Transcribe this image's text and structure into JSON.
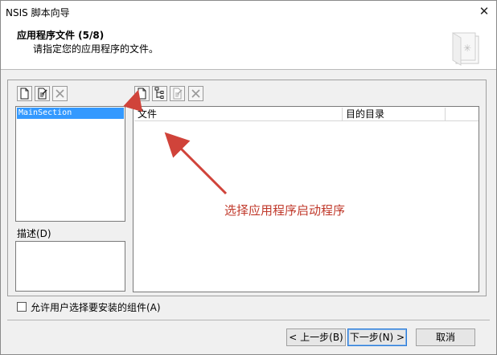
{
  "window": {
    "title": "NSIS 脚本向导",
    "close_glyph": "✕"
  },
  "header": {
    "title": "应用程序文件 (5/8)",
    "subtitle": "请指定您的应用程序的文件。",
    "icon": "wizard-page-icon"
  },
  "sections_toolbar": {
    "icons": [
      "new-file-icon",
      "edit-icon",
      "delete-icon"
    ]
  },
  "sections_list": {
    "items": [
      "MainSection"
    ],
    "selected": "MainSection"
  },
  "description": {
    "label": "描述(D)",
    "value": ""
  },
  "files_toolbar": {
    "icons": [
      "new-file-icon",
      "add-directory-icon",
      "edit-icon",
      "delete-icon"
    ]
  },
  "files_list": {
    "columns": [
      "文件",
      "目的目录"
    ],
    "rows": []
  },
  "annotation": {
    "text": "选择应用程序启动程序",
    "color": "#c0392b"
  },
  "checkbox": {
    "label": "允许用户选择要安装的组件(A)",
    "checked": false
  },
  "buttons": {
    "back": "< 上一步(B)",
    "next": "下一步(N) >",
    "cancel": "取消"
  }
}
